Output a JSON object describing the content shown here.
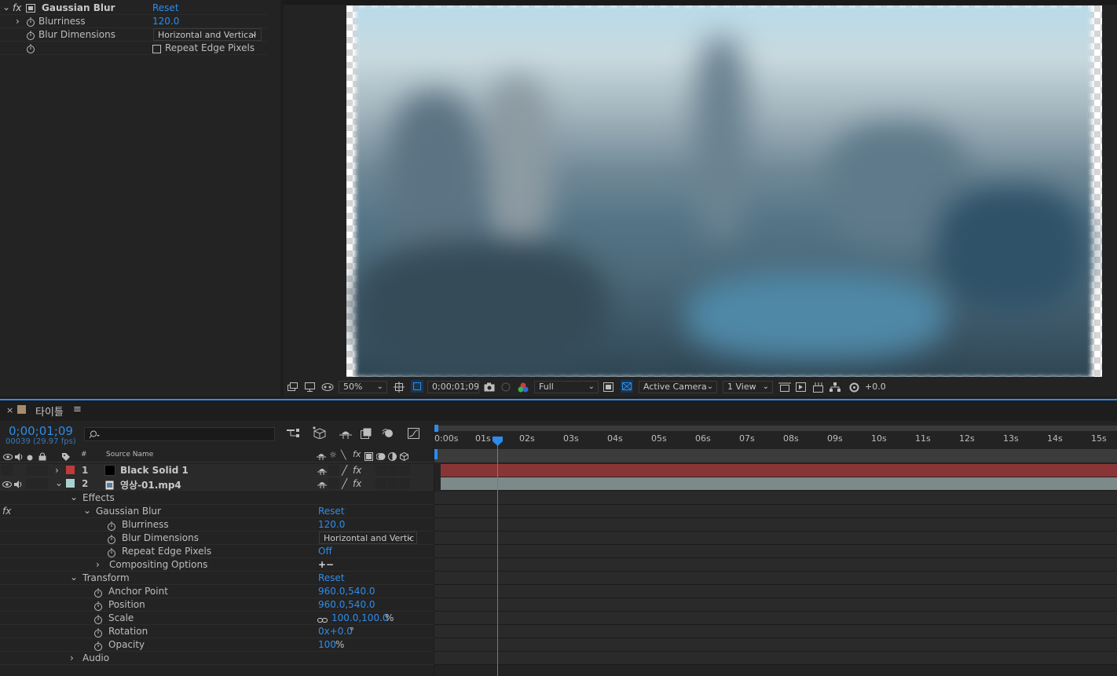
{
  "effect_controls": {
    "effect_name": "Gaussian Blur",
    "reset_label": "Reset",
    "props": [
      {
        "label": "Blurriness",
        "value": "120.0"
      },
      {
        "label": "Blur Dimensions",
        "value": "Horizontal and Vertical"
      },
      {
        "label": "",
        "value": "Repeat Edge Pixels"
      }
    ]
  },
  "viewer": {
    "zoom": "50%",
    "timecode": "0;00;01;09",
    "resolution": "Full",
    "camera": "Active Camera",
    "views": "1 View",
    "exposure": "+0.0"
  },
  "timeline": {
    "comp_name": "타이틀",
    "timecode": "0;00;01;09",
    "frame_info": "00039 (29.97 fps)",
    "search_placeholder": "",
    "column_source": "Source Name",
    "layers": [
      {
        "num": "1",
        "name": "Black Solid 1",
        "color": "#c0393b"
      },
      {
        "num": "2",
        "name": "영상-01.mp4",
        "color": "#a8d2cf"
      }
    ],
    "props": {
      "effects": "Effects",
      "gaussian": "Gaussian Blur",
      "reset": "Reset",
      "blurriness": "Blurriness",
      "blurriness_val": "120.0",
      "blur_dims": "Blur Dimensions",
      "blur_dims_val": "Horizontal and Vertic",
      "repeat_edge": "Repeat Edge Pixels",
      "repeat_edge_val": "Off",
      "compositing": "Compositing Options",
      "compositing_val": "+−",
      "transform": "Transform",
      "transform_reset": "Reset",
      "anchor": "Anchor Point",
      "anchor_val": "960.0,540.0",
      "position": "Position",
      "position_val": "960.0,540.0",
      "scale": "Scale",
      "scale_val": "100.0,100.0",
      "scale_unit": "%",
      "rotation": "Rotation",
      "rotation_val": "0x+0.0",
      "rotation_unit": "°",
      "opacity": "Opacity",
      "opacity_val": "100",
      "opacity_unit": "%",
      "audio": "Audio"
    },
    "ruler": [
      "0:00s",
      "01s",
      "02s",
      "03s",
      "04s",
      "05s",
      "06s",
      "07s",
      "08s",
      "09s",
      "10s",
      "11s",
      "12s",
      "13s",
      "14s",
      "15s"
    ]
  },
  "colors": {
    "accent": "#2d8ceb",
    "layer1": "#8a3535",
    "layer2": "#7c8a89"
  }
}
